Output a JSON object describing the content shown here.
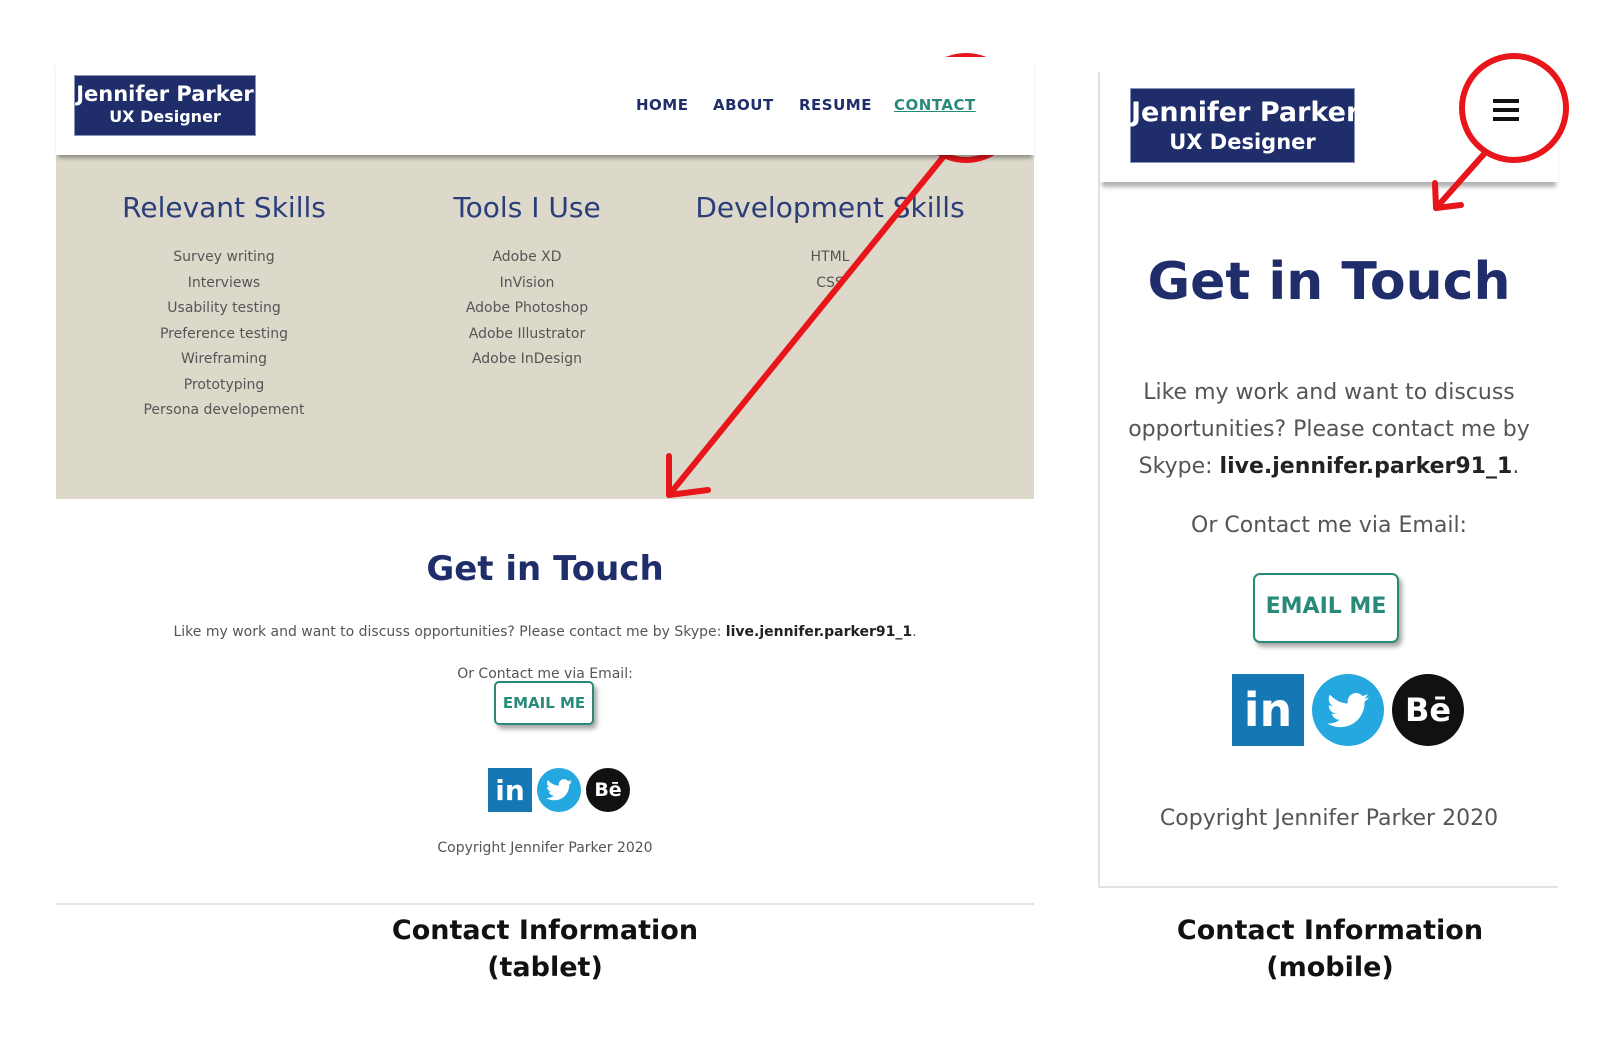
{
  "colors": {
    "navy": "#1f2d6b",
    "teal": "#2a8a7a",
    "skills_bg": "#dcd9cb",
    "annotation_red": "#e8161b",
    "linkedin": "#1677b5",
    "twitter": "#25a8e0",
    "behance": "#111111"
  },
  "tablet": {
    "logo": {
      "name": "Jennifer Parker",
      "title": "UX Designer"
    },
    "nav": [
      {
        "label": "HOME",
        "active": false
      },
      {
        "label": "ABOUT",
        "active": false
      },
      {
        "label": "RESUME",
        "active": false
      },
      {
        "label": "CONTACT",
        "active": true
      }
    ],
    "skills": [
      {
        "heading": "Relevant Skills",
        "items": [
          "Survey writing",
          "Interviews",
          "Usability testing",
          "Preference testing",
          "Wireframing",
          "Prototyping",
          "Persona developement"
        ]
      },
      {
        "heading": "Tools I Use",
        "items": [
          "Adobe XD",
          "InVision",
          "Adobe Photoshop",
          "Adobe Illustrator",
          "Adobe InDesign"
        ]
      },
      {
        "heading": "Development Skills",
        "items": [
          "HTML",
          "CSS"
        ]
      }
    ],
    "contact": {
      "heading": "Get in Touch",
      "intro": "Like my work and want to discuss opportunities? Please contact me by Skype: ",
      "skype": "live.jennifer.parker91_1",
      "intro_end": ".",
      "email_prompt": "Or Contact me via Email:",
      "email_button": "EMAIL ME",
      "copyright": "Copyright Jennifer Parker 2020"
    },
    "social": [
      {
        "icon": "linkedin-icon",
        "glyph": "in"
      },
      {
        "icon": "twitter-icon",
        "glyph": "bird"
      },
      {
        "icon": "behance-icon",
        "glyph": "Bē"
      }
    ]
  },
  "mobile": {
    "logo": {
      "name": "Jennifer Parker",
      "title": "UX Designer"
    },
    "menu_icon": "hamburger-menu-icon",
    "contact": {
      "heading": "Get in Touch",
      "intro": "Like my work and want to discuss opportunities? Please contact me by Skype: ",
      "skype": "live.jennifer.parker91_1",
      "intro_end": ".",
      "email_prompt": "Or Contact me via Email:",
      "email_button": "EMAIL ME",
      "copyright": "Copyright Jennifer Parker 2020"
    },
    "social": [
      {
        "icon": "linkedin-icon",
        "glyph": "in"
      },
      {
        "icon": "twitter-icon",
        "glyph": "bird"
      },
      {
        "icon": "behance-icon",
        "glyph": "Bē"
      }
    ]
  },
  "captions": {
    "tablet": [
      "Contact Information",
      "(tablet)"
    ],
    "mobile": [
      "Contact Information",
      "(mobile)"
    ]
  }
}
